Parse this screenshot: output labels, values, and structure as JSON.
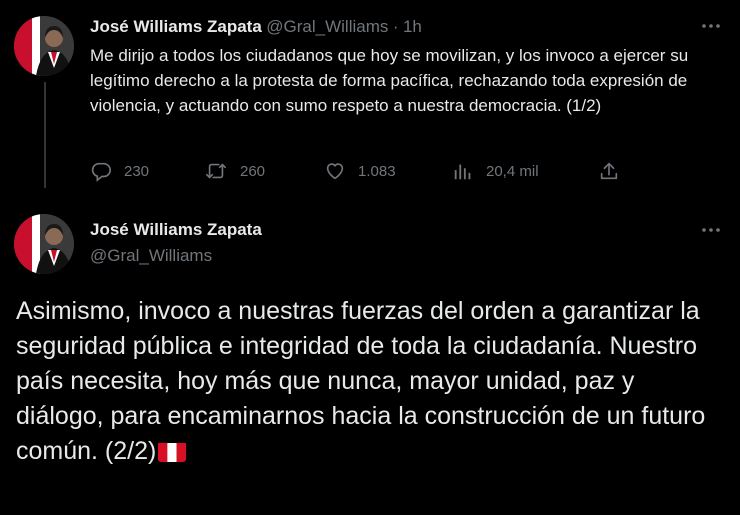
{
  "colors": {
    "background": "#000000",
    "text": "#e7e9ea",
    "muted": "#71767b",
    "line": "#333639"
  },
  "tweet1": {
    "author_name": "José Williams Zapata",
    "author_handle": "@Gral_Williams",
    "separator": "·",
    "time": "1h",
    "more_icon": "more-icon",
    "text": "Me dirijo a todos los ciudadanos que hoy se movilizan, y los invoco a ejercer su legítimo derecho a la protesta de forma pacífica, rechazando toda expresión de violencia, y actuando con sumo respeto a nuestra democracia. (1/2)",
    "actions": {
      "reply_count": "230",
      "retweet_count": "260",
      "like_count": "1.083",
      "views_count": "20,4 mil"
    },
    "icons": [
      "reply-icon",
      "retweet-icon",
      "like-icon",
      "views-icon",
      "share-icon"
    ]
  },
  "tweet2": {
    "author_name": "José Williams Zapata",
    "author_handle": "@Gral_Williams",
    "more_icon": "more-icon",
    "text": "Asimismo, invoco a nuestras fuerzas del orden a garantizar la seguridad pública e integridad de toda la ciudadanía. Nuestro país necesita, hoy más que nunca, mayor unidad, paz y diálogo, para encaminarnos hacia la construcción de un futuro común. (2/2)",
    "emoji": "peru-flag-emoji"
  }
}
